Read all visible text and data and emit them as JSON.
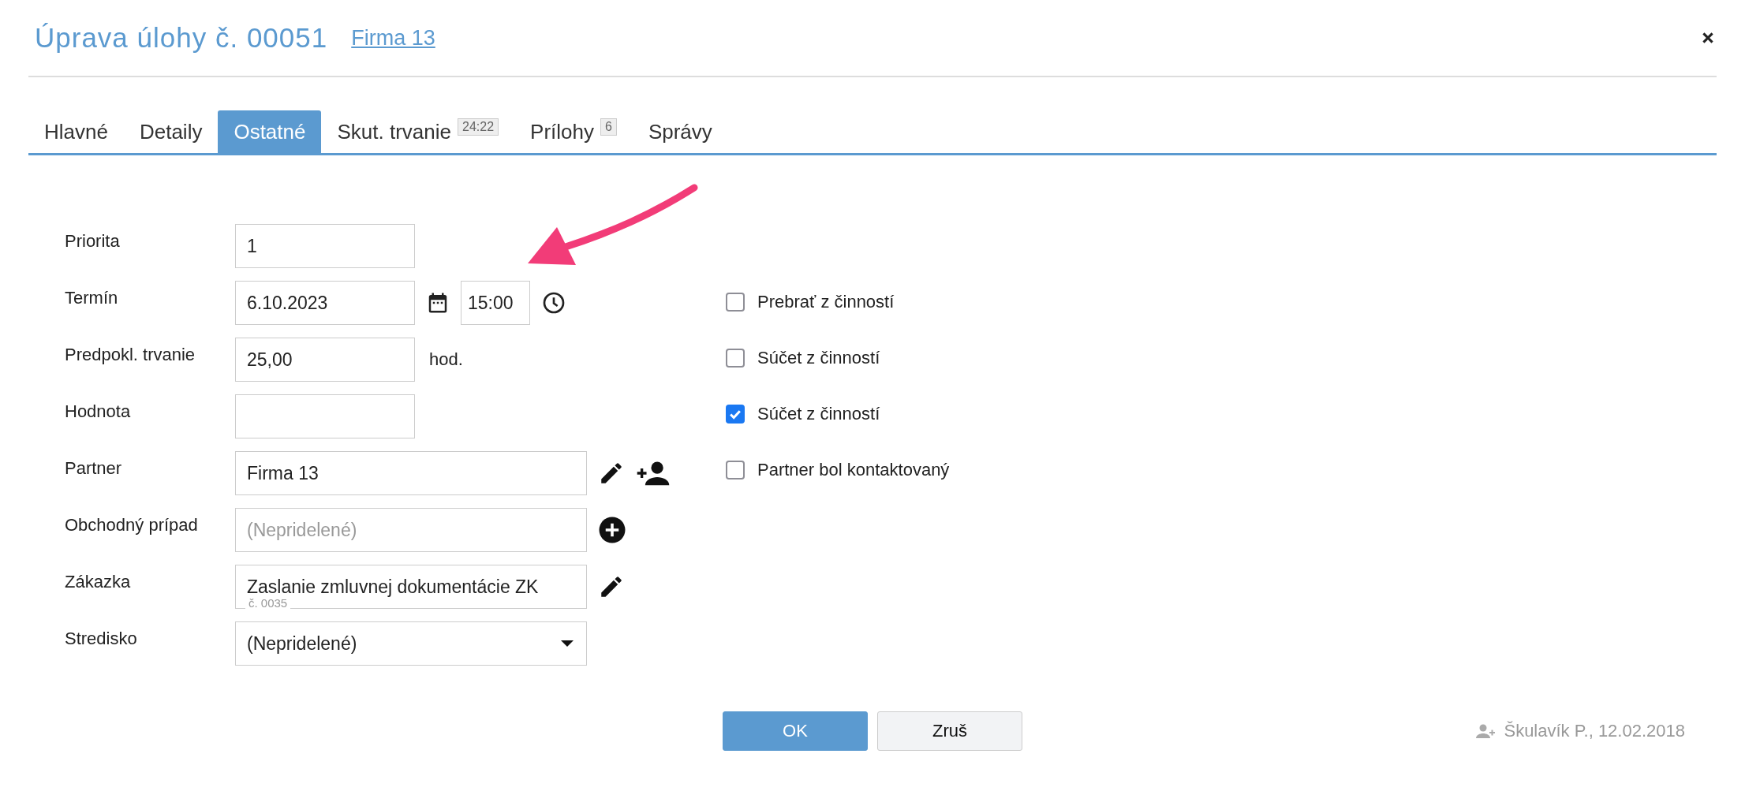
{
  "title": "Úprava úlohy č. 00051",
  "title_link": "Firma 13",
  "tabs": [
    {
      "label": "Hlavné",
      "selected": false
    },
    {
      "label": "Detaily",
      "selected": false
    },
    {
      "label": "Ostatné",
      "selected": true
    },
    {
      "label": "Skut. trvanie",
      "badge": "24:22",
      "selected": false
    },
    {
      "label": "Prílohy",
      "badge": "6",
      "selected": false
    },
    {
      "label": "Správy",
      "selected": false
    }
  ],
  "fields": [
    {
      "kind": "text",
      "label": "Priorita",
      "value": "1"
    },
    {
      "kind": "datetime",
      "label": "Termín",
      "value": "6.10.2023",
      "time": "15:00"
    },
    {
      "kind": "unit",
      "label": "Predpokl. trvanie",
      "value": "25,00",
      "unit": "hod."
    },
    {
      "kind": "text",
      "label": "Hodnota"
    },
    {
      "kind": "partner",
      "label": "Partner",
      "value": "Firma 13"
    },
    {
      "kind": "add",
      "label": "Obchodný prípad",
      "placeholder": "(Nepridelené)"
    },
    {
      "kind": "edit",
      "label": "Zákazka",
      "value": "Zaslanie zmluvnej dokumentácie ZK",
      "caption": "č. 0035"
    },
    {
      "kind": "select",
      "label": "Stredisko",
      "value": "(Nepridelené)"
    }
  ],
  "checkboxes": [
    {
      "label": "Prebrať z činností",
      "checked": false
    },
    {
      "label": "Súčet z činností",
      "checked": false
    },
    {
      "label": "Súčet z činností",
      "checked": true
    },
    {
      "label": "Partner bol kontaktovaný",
      "checked": false
    }
  ],
  "buttons": [
    {
      "label": "OK",
      "kind": "primary"
    },
    {
      "label": "Zruš",
      "kind": "secondary"
    }
  ],
  "footer": "Škulavík P., 12.02.2018"
}
